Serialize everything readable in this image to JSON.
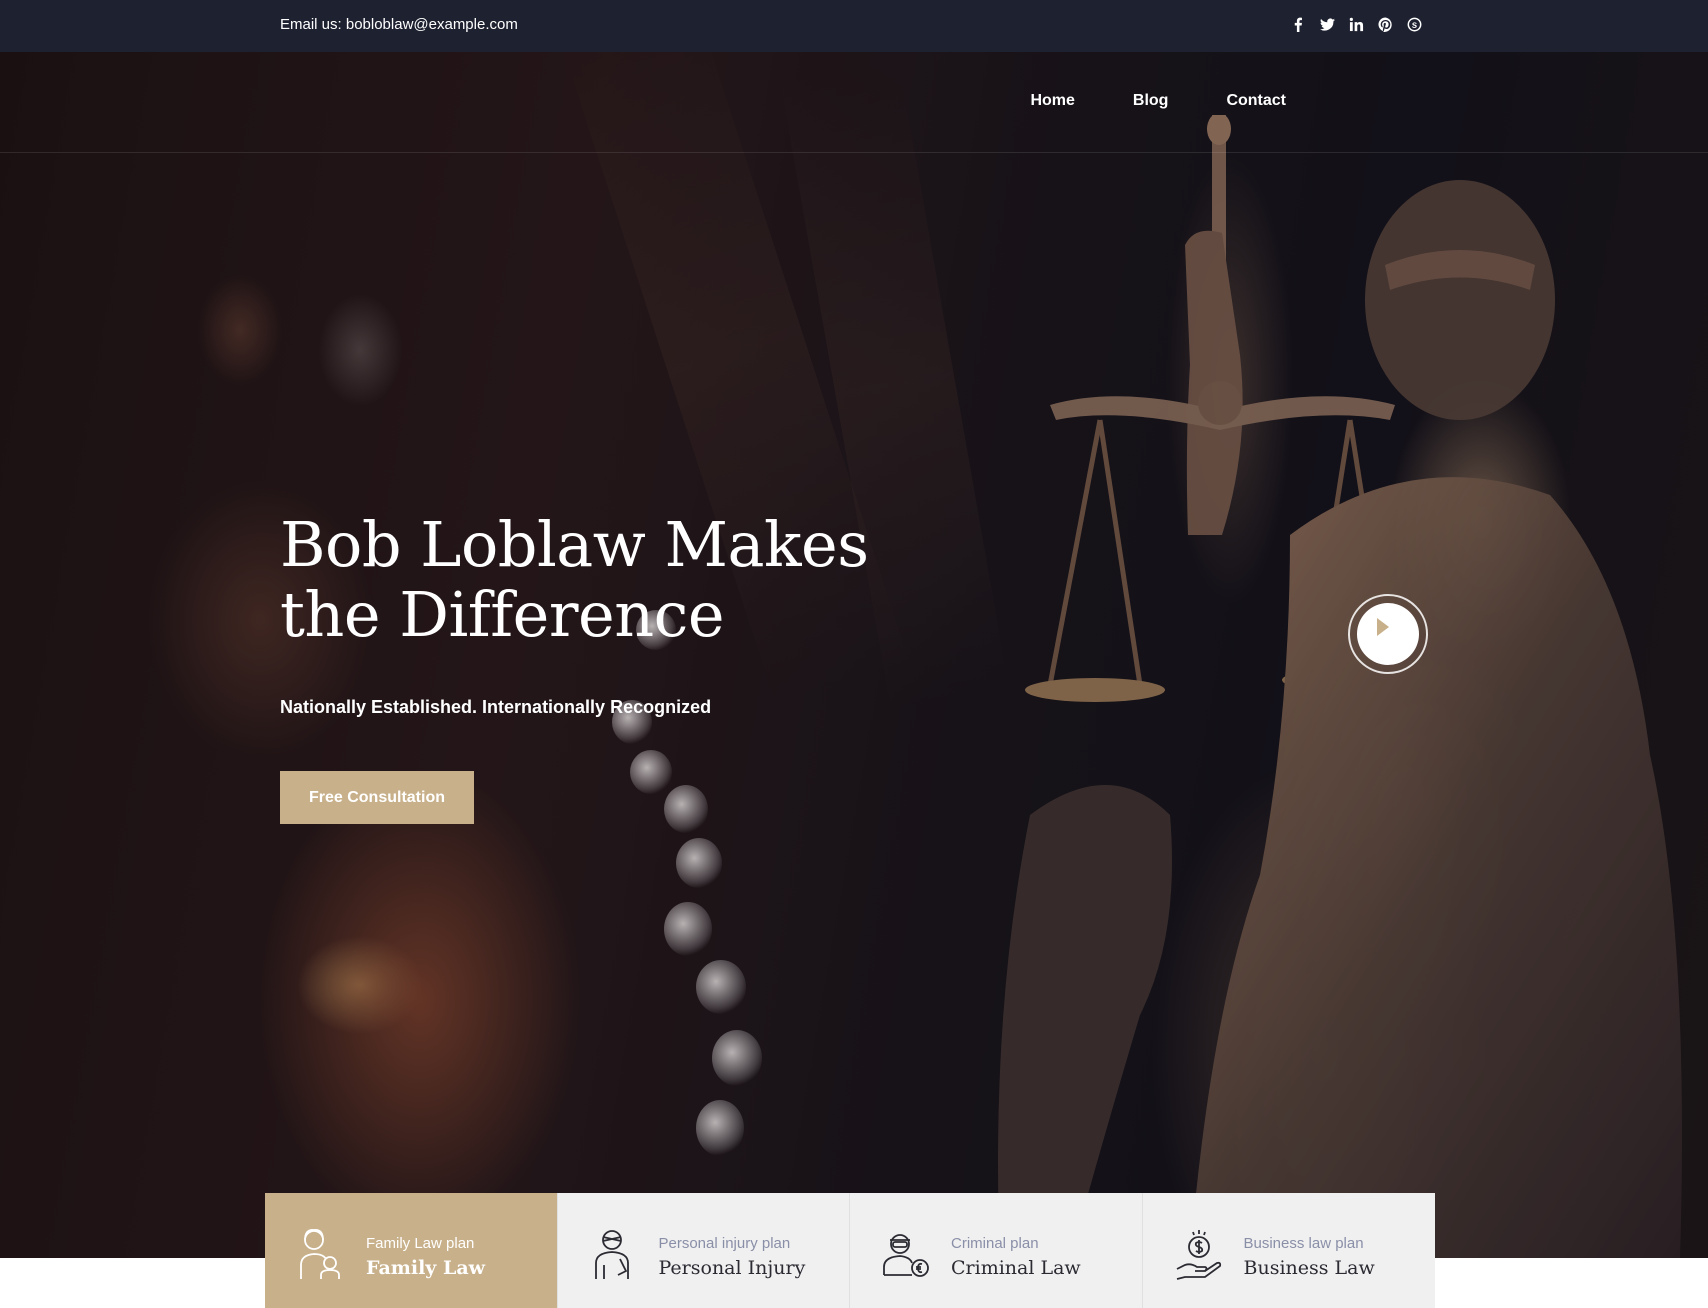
{
  "topbar": {
    "email": "Email us: bobloblaw@example.com",
    "socials": [
      {
        "icon": "facebook-icon"
      },
      {
        "icon": "twitter-icon"
      },
      {
        "icon": "linkedin-icon"
      },
      {
        "icon": "pinterest-icon"
      },
      {
        "icon": "skype-icon"
      }
    ]
  },
  "nav": {
    "items": [
      {
        "label": "Home"
      },
      {
        "label": "Blog"
      },
      {
        "label": "Contact"
      }
    ]
  },
  "hero": {
    "headline_line1": "Bob Loblaw Makes",
    "headline_line2": "the Difference",
    "tagline": "Nationally Established. Internationally Recognized",
    "cta_label": "Free Consultation",
    "play_icon": "play-icon"
  },
  "services": [
    {
      "plan": "Family Law plan",
      "title": "Family Law",
      "icon": "family-icon",
      "active": true
    },
    {
      "plan": "Personal injury plan",
      "title": "Personal Injury",
      "icon": "injury-icon",
      "active": false
    },
    {
      "plan": "Criminal plan",
      "title": "Criminal Law",
      "icon": "criminal-icon",
      "active": false
    },
    {
      "plan": "Business law plan",
      "title": "Business Law",
      "icon": "business-icon",
      "active": false
    }
  ],
  "colors": {
    "accent": "#c8b08a",
    "topbar": "#1e2130",
    "card_bg": "#f0f0f0",
    "card_plan_text": "#8a8fa8",
    "card_title_text": "#2b2b33"
  }
}
